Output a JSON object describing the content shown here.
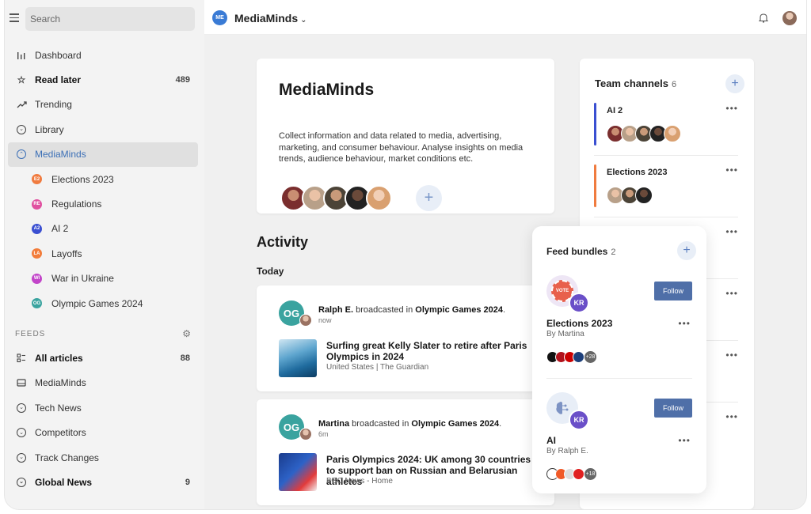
{
  "sidebar": {
    "search_placeholder": "Search",
    "items": [
      {
        "label": "Dashboard",
        "icon": "bar-chart-icon"
      },
      {
        "label": "Read later",
        "count": "489",
        "icon": "star-icon"
      },
      {
        "label": "Trending",
        "icon": "trending-icon"
      },
      {
        "label": "Library",
        "icon": "chevron-circle-icon"
      },
      {
        "label": "MediaMinds",
        "icon": "chevron-up-circle-icon"
      }
    ],
    "sub_items": [
      {
        "label": "Elections 2023",
        "badge": "E2",
        "color": "#f07b3f"
      },
      {
        "label": "Regulations",
        "badge": "RE",
        "color": "#e04f9f"
      },
      {
        "label": "AI 2",
        "badge": "A2",
        "color": "#3a4fd1"
      },
      {
        "label": "Layoffs",
        "badge": "LA",
        "color": "#f27c3a"
      },
      {
        "label": "War in Ukraine",
        "badge": "WI",
        "color": "#c245c9"
      },
      {
        "label": "Olympic Games 2024",
        "badge": "OG",
        "color": "#3aa39f"
      }
    ],
    "feeds_label": "FEEDS",
    "feeds": [
      {
        "label": "All articles",
        "count": "88"
      },
      {
        "label": "MediaMinds"
      },
      {
        "label": "Tech News"
      },
      {
        "label": "Competitors"
      },
      {
        "label": "Track Changes"
      },
      {
        "label": "Global News",
        "count": "9"
      }
    ]
  },
  "topbar": {
    "badge": "ME",
    "title": "MediaMinds"
  },
  "hero": {
    "title": "MediaMinds",
    "description": "Collect information and data related to media, advertising, marketing, and consumer behaviour. Analyse insights on media trends, audience behaviour, market conditions etc."
  },
  "activity": {
    "title": "Activity",
    "today": "Today",
    "items": [
      {
        "initials": "OG",
        "user": "Ralph E.",
        "verb": " broadcasted in ",
        "channel": "Olympic Games 2024",
        "time": "now",
        "headline": "Surfing great Kelly Slater to retire after Paris Olympics in 2024",
        "source": "United States | The Guardian"
      },
      {
        "initials": "OG",
        "user": "Martina",
        "verb": " broadcasted in ",
        "channel": "Olympic Games 2024",
        "time": "6m",
        "headline": "Paris Olympics 2024: UK among 30 countries to support ban on Russian and Belarusian athletes",
        "source": "BBC News - Home"
      }
    ]
  },
  "team": {
    "title": "Team channels",
    "count": "6",
    "channels": [
      {
        "name": "AI 2",
        "color": "#3a4fd1"
      },
      {
        "name": "Elections 2023",
        "color": "#f07b3f"
      }
    ]
  },
  "bundles": {
    "title": "Feed bundles",
    "count": "2",
    "items": [
      {
        "title": "Elections 2023",
        "by": "By Martina",
        "initials": "KR",
        "follow": "Follow",
        "more": "+28",
        "logo_text": "VOTE"
      },
      {
        "title": "AI",
        "by": "By Ralph E.",
        "initials": "KR",
        "follow": "Follow",
        "more": "+18"
      }
    ]
  }
}
